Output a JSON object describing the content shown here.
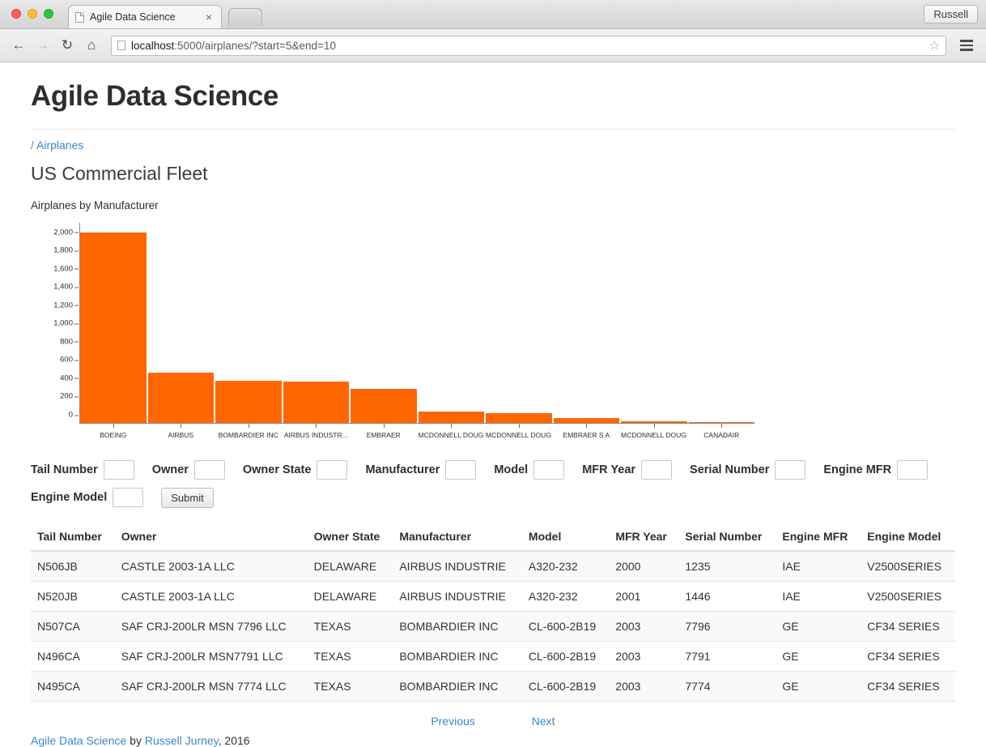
{
  "browser": {
    "tab_title": "Agile Data Science",
    "tab_close": "×",
    "profile_label": "Russell",
    "url_host": "localhost",
    "url_rest": ":5000/airplanes/?start=5&end=10",
    "back_icon": "←",
    "forward_icon": "→",
    "reload_icon": "↻",
    "home_icon": "⌂",
    "star_icon": "☆"
  },
  "page": {
    "site_title": "Agile Data Science",
    "breadcrumb_prefix": "/",
    "breadcrumb_link": "Airplanes",
    "section_title": "US Commercial Fleet",
    "chart_caption": "Airplanes by Manufacturer"
  },
  "chart_data": {
    "type": "bar",
    "title": "Airplanes by Manufacturer",
    "xlabel": "",
    "ylabel": "",
    "ylim": [
      0,
      2200
    ],
    "grid": false,
    "legend": "none",
    "categories": [
      "BOEING",
      "AIRBUS",
      "BOMBARDIER INC",
      "AIRBUS INDUSTR...",
      "EMBRAER",
      "MCDONNELL DOUG...",
      "MCDONNELL DOUG...",
      "EMBRAER S A",
      "MCDONNELL DOUG...",
      "CANADAIR"
    ],
    "values": [
      2090,
      545,
      462,
      453,
      370,
      120,
      105,
      45,
      10,
      5
    ],
    "bar_color": "#ff6600",
    "y_ticks": [
      "0",
      "200",
      "400",
      "600",
      "800",
      "1,000",
      "1,200",
      "1,400",
      "1,600",
      "1,800",
      "2,000"
    ],
    "y_tick_values": [
      0,
      200,
      400,
      600,
      800,
      1000,
      1200,
      1400,
      1600,
      1800,
      2000
    ]
  },
  "filter_form": {
    "fields": [
      {
        "label": "Tail Number",
        "value": ""
      },
      {
        "label": "Owner",
        "value": ""
      },
      {
        "label": "Owner State",
        "value": ""
      },
      {
        "label": "Manufacturer",
        "value": ""
      },
      {
        "label": "Model",
        "value": ""
      },
      {
        "label": "MFR Year",
        "value": ""
      },
      {
        "label": "Serial Number",
        "value": ""
      },
      {
        "label": "Engine MFR",
        "value": ""
      },
      {
        "label": "Engine Model",
        "value": ""
      }
    ],
    "submit_label": "Submit"
  },
  "table": {
    "columns": [
      "Tail Number",
      "Owner",
      "Owner State",
      "Manufacturer",
      "Model",
      "MFR Year",
      "Serial Number",
      "Engine MFR",
      "Engine Model"
    ],
    "rows": [
      [
        "N506JB",
        "CASTLE 2003-1A LLC",
        "DELAWARE",
        "AIRBUS INDUSTRIE",
        "A320-232",
        "2000",
        "1235",
        "IAE",
        "V2500SERIES"
      ],
      [
        "N520JB",
        "CASTLE 2003-1A LLC",
        "DELAWARE",
        "AIRBUS INDUSTRIE",
        "A320-232",
        "2001",
        "1446",
        "IAE",
        "V2500SERIES"
      ],
      [
        "N507CA",
        "SAF CRJ-200LR MSN 7796 LLC",
        "TEXAS",
        "BOMBARDIER INC",
        "CL-600-2B19",
        "2003",
        "7796",
        "GE",
        "CF34 SERIES"
      ],
      [
        "N496CA",
        "SAF CRJ-200LR MSN7791 LLC",
        "TEXAS",
        "BOMBARDIER INC",
        "CL-600-2B19",
        "2003",
        "7791",
        "GE",
        "CF34 SERIES"
      ],
      [
        "N495CA",
        "SAF CRJ-200LR MSN 7774 LLC",
        "TEXAS",
        "BOMBARDIER INC",
        "CL-600-2B19",
        "2003",
        "7774",
        "GE",
        "CF34 SERIES"
      ]
    ]
  },
  "pagination": {
    "previous": "Previous",
    "next": "Next"
  },
  "footer": {
    "link_title": "Agile Data Science",
    "by": " by ",
    "author": "Russell Jurney",
    "year": ", 2016"
  }
}
